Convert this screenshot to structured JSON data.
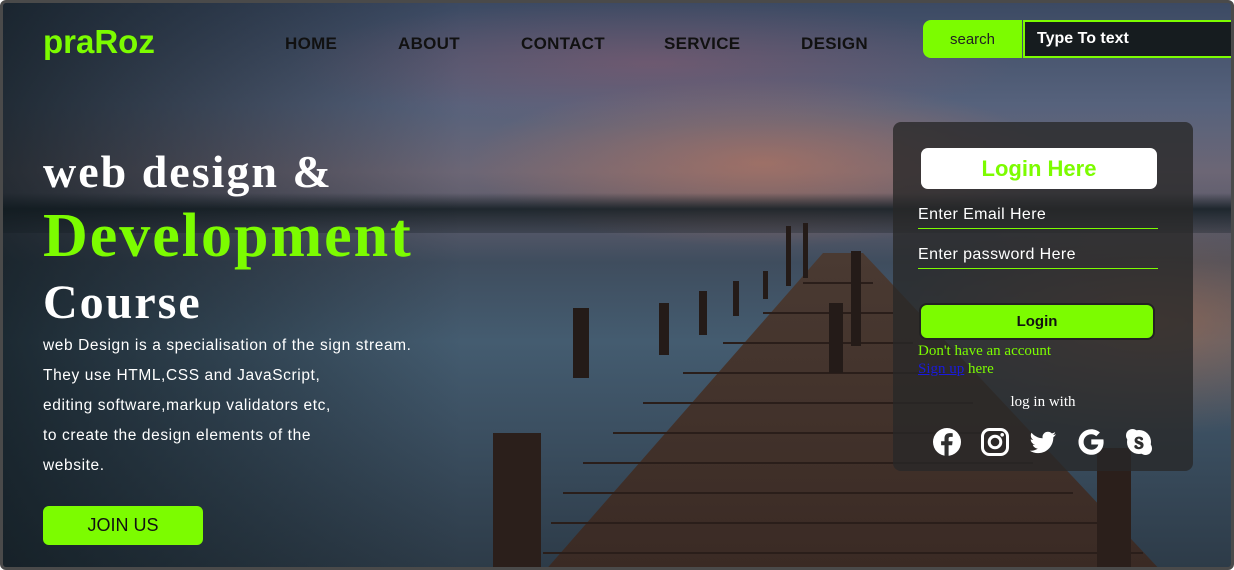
{
  "header": {
    "logo": "praRoz",
    "nav": [
      "HOME",
      "ABOUT",
      "CONTACT",
      "SERVICE",
      "DESIGN"
    ],
    "search_label": "search",
    "search_placeholder": "Type To text"
  },
  "hero": {
    "line1": "web design &",
    "line2": "Development",
    "line3": "Course",
    "description": [
      "web Design is a specialisation of the sign stream.",
      "They use HTML,CSS and JavaScript,",
      "editing software,markup validators etc,",
      "to create the design elements of the",
      "website."
    ],
    "join_label": "JOIN US"
  },
  "login": {
    "title": "Login Here",
    "email_placeholder": "Enter Email Here",
    "password_placeholder": "Enter password Here",
    "button_label": "Login",
    "no_account": "Don't have an account",
    "signup_link": "Sign up",
    "signup_suffix": " here",
    "login_with": "log in with",
    "social_icons": [
      "facebook-icon",
      "instagram-icon",
      "twitter-icon",
      "google-icon",
      "skype-icon"
    ]
  },
  "colors": {
    "accent": "#7cfc00",
    "panel": "#282828",
    "text": "#ffffff"
  }
}
